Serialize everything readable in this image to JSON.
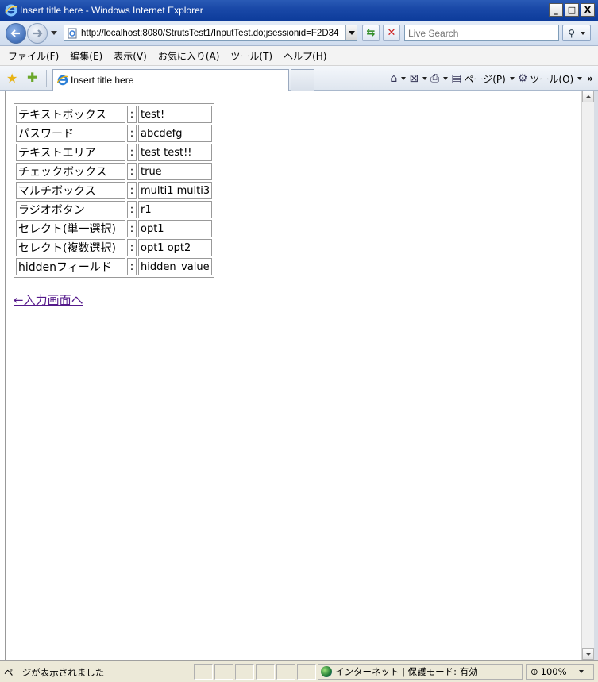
{
  "window": {
    "title": "Insert title here - Windows Internet Explorer",
    "minimize": "_",
    "maximize": "□",
    "close": "X"
  },
  "address_bar": {
    "url": "http://localhost:8080/StrutsTest1/InputTest.do;jsessionid=F2D34",
    "search_placeholder": "Live Search"
  },
  "menu": [
    "ファイル(F)",
    "編集(E)",
    "表示(V)",
    "お気に入り(A)",
    "ツール(T)",
    "ヘルプ(H)"
  ],
  "tab": {
    "label": "Insert title here"
  },
  "command_bar": {
    "page_label": "ページ(P)",
    "tools_label": "ツール(O)",
    "more": "»"
  },
  "results": [
    {
      "key": "テキストボックス",
      "sep": ":",
      "value": "test!"
    },
    {
      "key": "パスワード",
      "sep": ":",
      "value": "abcdefg"
    },
    {
      "key": "テキストエリア",
      "sep": ":",
      "value": "test test!!"
    },
    {
      "key": "チェックボックス",
      "sep": ":",
      "value": "true"
    },
    {
      "key": "マルチボックス",
      "sep": ":",
      "value": "multi1 multi3"
    },
    {
      "key": "ラジオボタン",
      "sep": ":",
      "value": "r1"
    },
    {
      "key": "セレクト(単一選択)",
      "sep": ":",
      "value": "opt1"
    },
    {
      "key": "セレクト(複数選択)",
      "sep": ":",
      "value": "opt1 opt2"
    },
    {
      "key": "hiddenフィールド",
      "sep": ":",
      "value": "hidden_value"
    }
  ],
  "back_link": "←入力画面へ",
  "status": {
    "text": "ページが表示されました",
    "zone": "インターネット | 保護モード: 有効",
    "zoom": "100%"
  },
  "colors": {
    "title_bar": "#1a49a8",
    "link_visited": "#551a8b"
  }
}
